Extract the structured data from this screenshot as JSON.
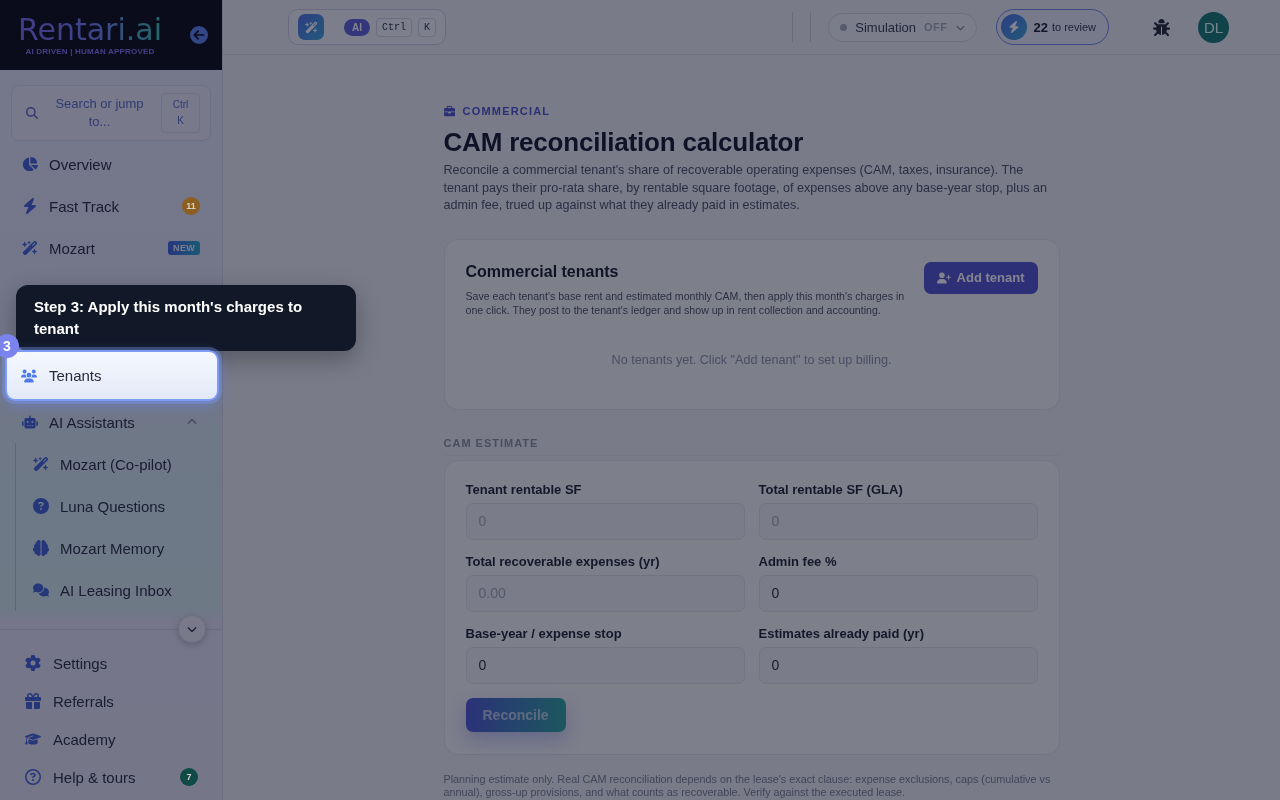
{
  "sidebar": {
    "logo": {
      "wordmark": "Rentari.ai",
      "tagline": "AI DRIVEN | HUMAN APPROVED"
    },
    "search": {
      "placeholder": "Search or jump to...",
      "shortcut": "Ctrl K"
    },
    "nav": [
      {
        "kind": "link",
        "label": "Overview",
        "spotlight": false
      },
      {
        "kind": "link",
        "label": "Fast Track",
        "spotlight": false,
        "badge": {
          "kind": "count",
          "text": "11",
          "color": "#8c5e20"
        }
      },
      {
        "kind": "link",
        "label": "Mozart",
        "spotlight": false,
        "badge": {
          "kind": "tag",
          "text": "NEW"
        }
      },
      {
        "kind": "link",
        "label": "Tenants",
        "spotlight": true,
        "tour": {
          "step": "3",
          "message": "Step 3: Apply this month's charges to tenant"
        }
      },
      {
        "kind": "group",
        "label": "AI Assistants",
        "spotlight": false,
        "expanded": true,
        "children": [
          {
            "label": "Mozart (Co-pilot)"
          },
          {
            "label": "Luna Questions"
          },
          {
            "label": "Mozart Memory"
          },
          {
            "label": "AI Leasing Inbox"
          }
        ]
      }
    ],
    "footer_nav": [
      {
        "label": "Settings"
      },
      {
        "label": "Referrals"
      },
      {
        "label": "Academy"
      },
      {
        "label": "Help & tours",
        "badge": {
          "kind": "count",
          "text": "7",
          "color": "#0f4a47"
        }
      }
    ]
  },
  "topbar": {
    "command": {
      "tag": "AI",
      "keys": [
        "Ctrl",
        "K"
      ]
    },
    "simulation": {
      "label": "Simulation",
      "state": "OFF",
      "on": false
    },
    "review": {
      "count": "22",
      "label": "to review"
    },
    "avatar": {
      "initials": "DL"
    }
  },
  "page": {
    "eyebrow": "COMMERCIAL",
    "title": "CAM reconciliation calculator",
    "description": "Reconcile a commercial tenant's share of recoverable operating expenses (CAM, taxes, insurance). The tenant pays their pro-rata share, by rentable square footage, of expenses above any base-year stop, plus an admin fee, trued up against what they already paid in estimates."
  },
  "tenants_card": {
    "title": "Commercial tenants",
    "description": "Save each tenant's base rent and estimated monthly CAM, then apply this month's charges in one click. They post to the tenant's ledger and show up in rent collection and accounting.",
    "add_button": "Add tenant",
    "empty_message": "No tenants yet. Click \"Add tenant\" to set up billing."
  },
  "estimate": {
    "heading": "CAM ESTIMATE",
    "fields": [
      {
        "label": "Tenant rentable SF",
        "placeholder": "0"
      },
      {
        "label": "Total rentable SF (GLA)",
        "placeholder": "0"
      },
      {
        "label": "Total recoverable expenses (yr)",
        "placeholder": "0.00"
      },
      {
        "label": "Admin fee %",
        "value": "0"
      },
      {
        "label": "Base-year / expense stop",
        "value": "0"
      },
      {
        "label": "Estimates already paid (yr)",
        "value": "0"
      }
    ],
    "submit": {
      "label": "Reconcile",
      "disabled": true
    }
  },
  "disclaimer": "Planning estimate only. Real CAM reconciliation depends on the lease's exact clause: expense exclusions, caps (cumulative vs annual), gross-up provisions, and what counts as recoverable. Verify against the executed lease."
}
